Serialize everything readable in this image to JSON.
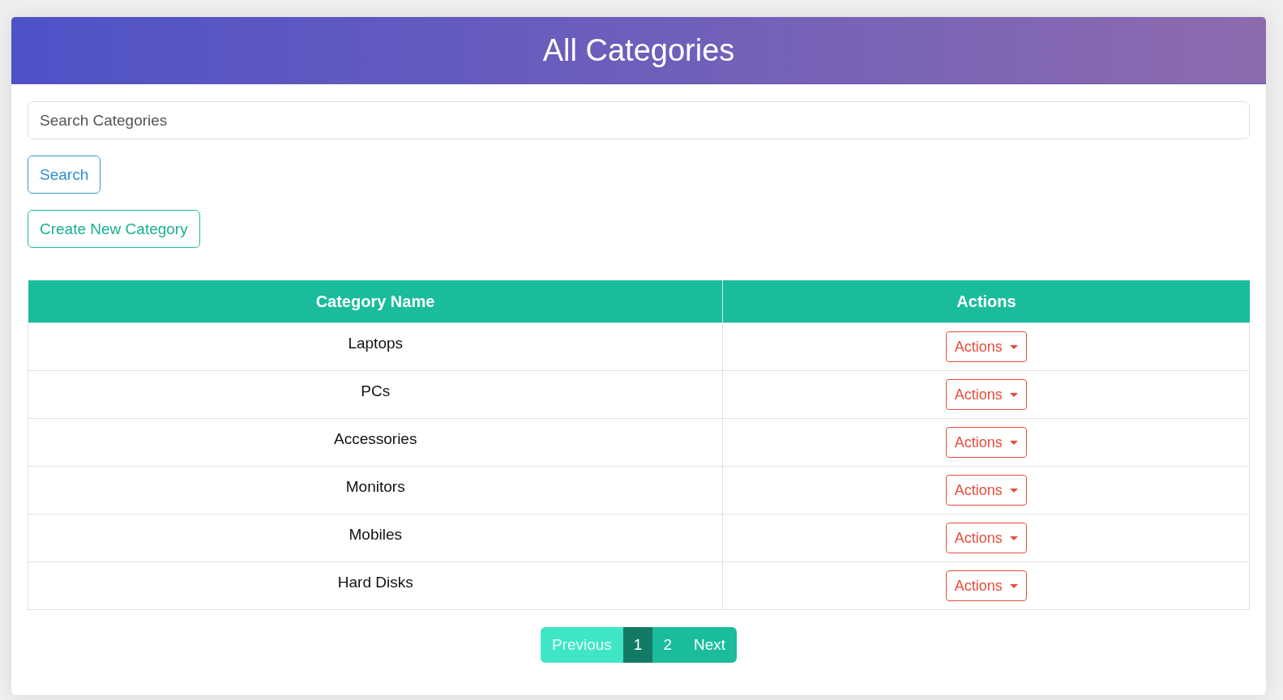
{
  "header": {
    "title": "All Categories"
  },
  "search": {
    "placeholder": "Search Categories",
    "button": "Search"
  },
  "create_button": "Create New Category",
  "table": {
    "columns": [
      "Category Name",
      "Actions"
    ],
    "rows": [
      {
        "name": "Laptops",
        "action": "Actions"
      },
      {
        "name": "PCs",
        "action": "Actions"
      },
      {
        "name": "Accessories",
        "action": "Actions"
      },
      {
        "name": "Monitors",
        "action": "Actions"
      },
      {
        "name": "Mobiles",
        "action": "Actions"
      },
      {
        "name": "Hard Disks",
        "action": "Actions"
      }
    ]
  },
  "pagination": {
    "items": [
      {
        "label": "Previous",
        "kind": "previous",
        "disabled": true,
        "selected": false
      },
      {
        "label": "1",
        "kind": "page",
        "disabled": false,
        "selected": true
      },
      {
        "label": "2",
        "kind": "page",
        "disabled": false,
        "selected": false
      },
      {
        "label": "Next",
        "kind": "next",
        "disabled": false,
        "selected": false
      }
    ]
  }
}
